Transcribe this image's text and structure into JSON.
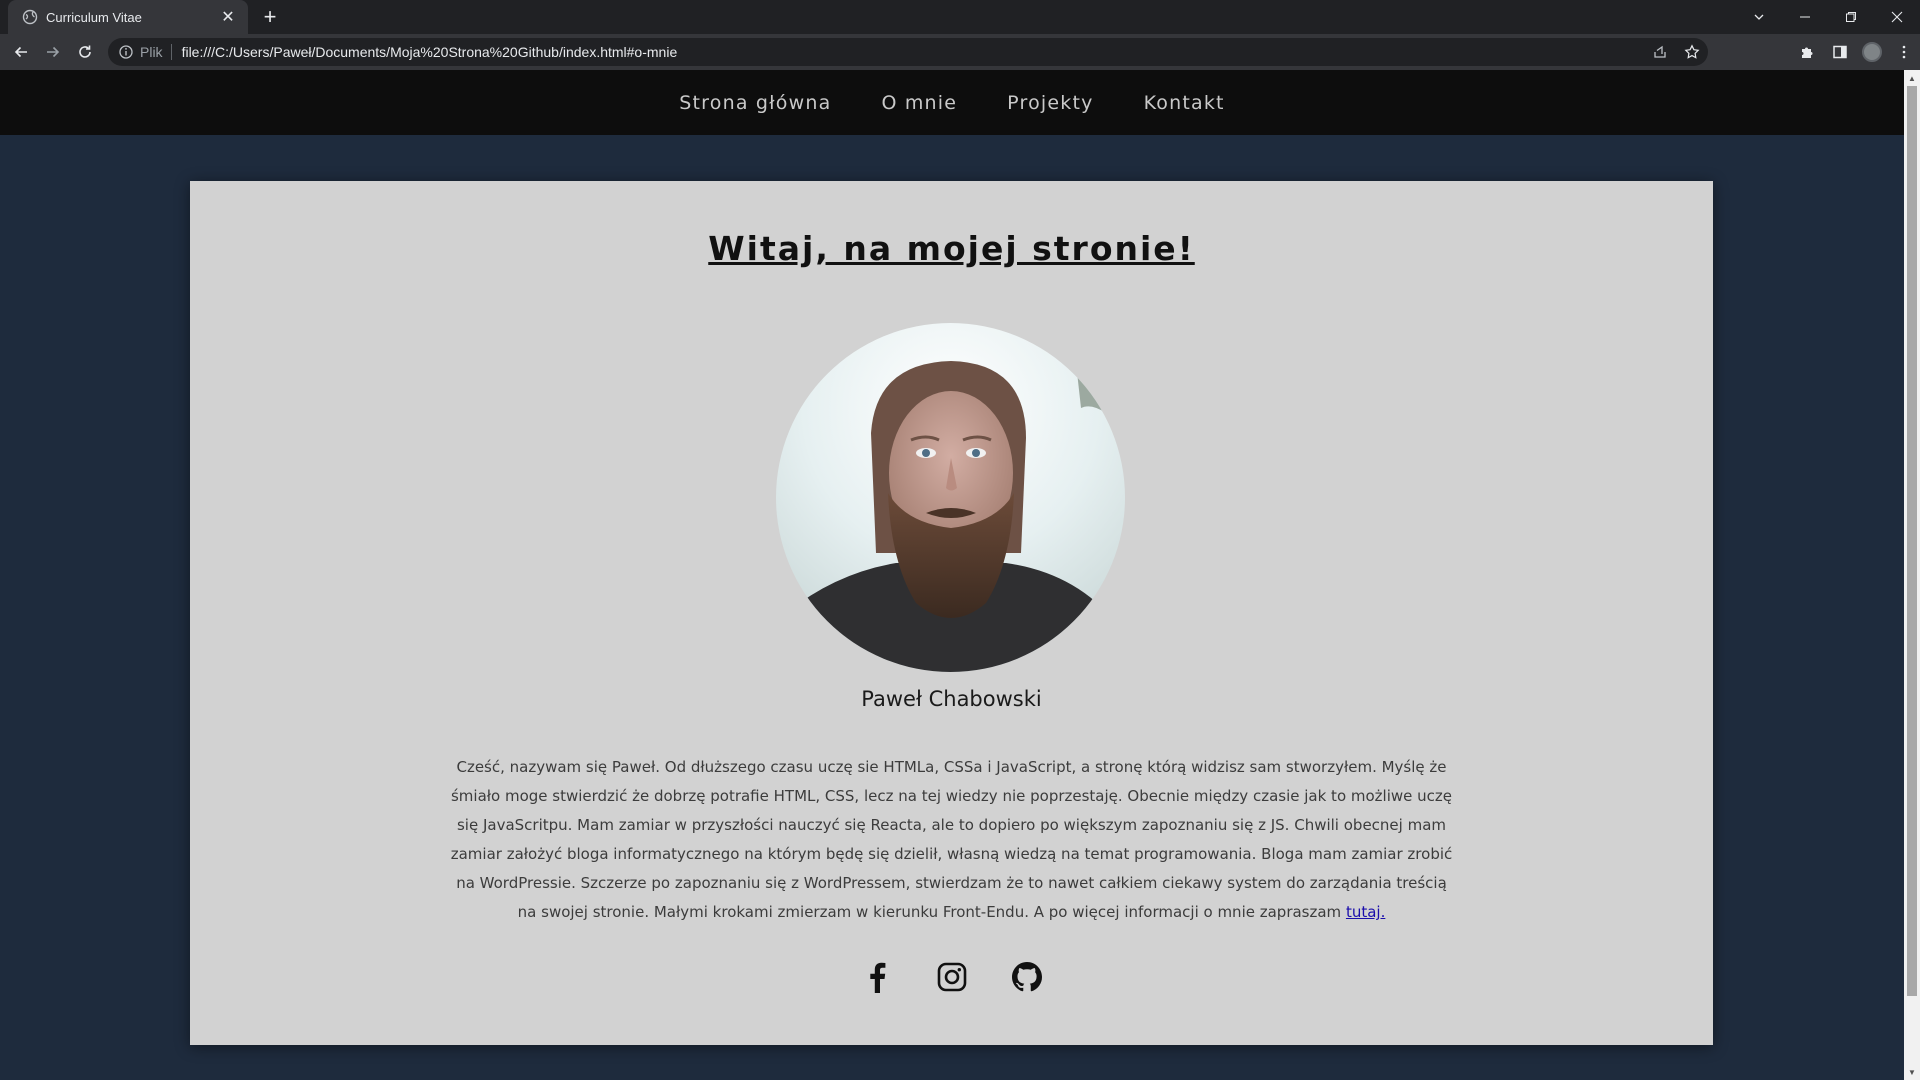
{
  "browser": {
    "tab_title": "Curriculum Vitae",
    "scheme_label": "Plik",
    "url": "file:///C:/Users/Paweł/Documents/Moja%20Strona%20Github/index.html#o-mnie",
    "icons": [
      "globe-icon",
      "close-icon",
      "plus-icon",
      "chevron-down-icon",
      "minimize-icon",
      "restore-icon",
      "window-close-icon",
      "back-icon",
      "forward-icon",
      "reload-icon",
      "info-icon",
      "share-icon",
      "star-icon",
      "puzzle-icon",
      "sidepanel-icon",
      "profile-icon",
      "kebab-icon"
    ]
  },
  "site": {
    "nav": [
      "Strona główna",
      "O mnie",
      "Projekty",
      "Kontakt"
    ],
    "heading": "Witaj, na mojej stronie!",
    "photo_alt": "portrait-photo",
    "name": "Paweł Chabowski",
    "bio": "Cześć, nazywam się Paweł. Od dłuższego czasu uczę sie HTMLa, CSSa i JavaScript, a stronę którą widzisz sam stworzyłem. Myślę że śmiało moge stwierdzić że dobrzę potrafie HTML, CSS, lecz na tej wiedzy nie poprzestaję. Obecnie między czasie jak to możliwe uczę się JavaScritpu. Mam zamiar w przyszłości nauczyć się Reacta, ale to dopiero po większym zapoznaniu się z JS. Chwili obecnej mam zamiar założyć bloga informatycznego na którym będę się dzielił, własną wiedzą na temat programowania. Bloga mam zamiar zrobić na WordPressie. Szczerze po zapoznaniu się z WordPressem, stwierdzam że to nawet całkiem ciekawy system do zarządania treścią na swojej stronie. Małymi krokami zmierzam w kierunku Front-Endu. A po więcej informacji o mnie zapraszam ",
    "bio_link": "tutaj.",
    "socials": [
      "facebook-icon",
      "instagram-icon",
      "github-icon"
    ]
  },
  "colors": {
    "page_bg": "#1e2b3d",
    "nav_bg": "#0d0d0d",
    "card_bg": "#d2d2d2",
    "link": "#1a0dab"
  }
}
